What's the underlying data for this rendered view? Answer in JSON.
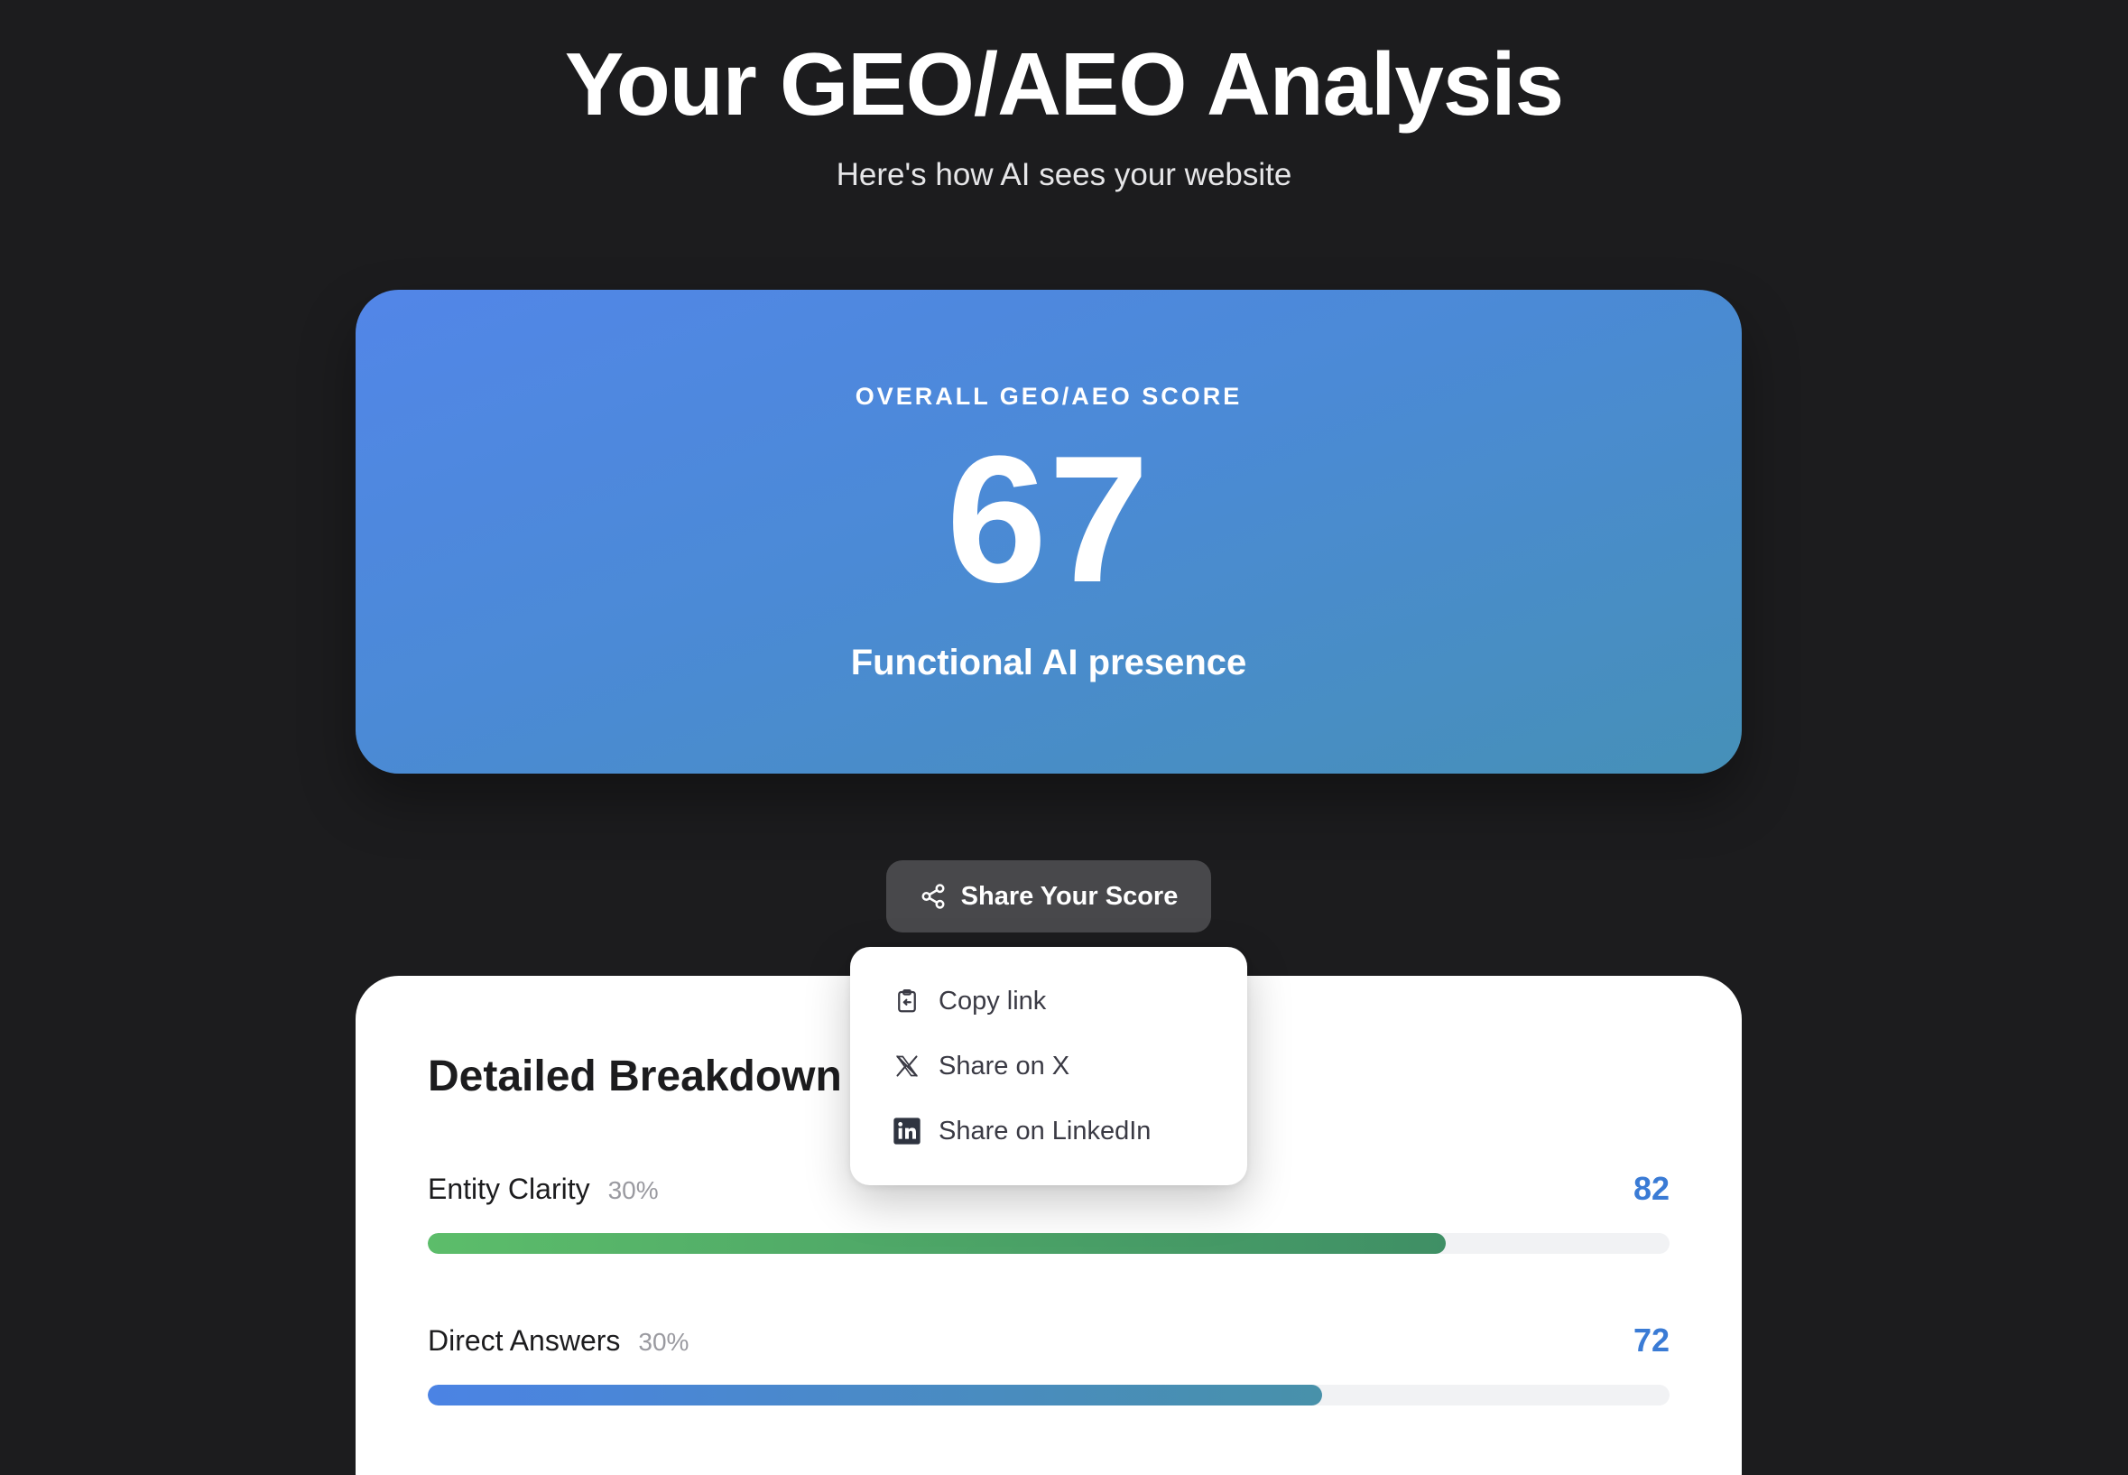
{
  "header": {
    "title": "Your GEO/AEO Analysis",
    "subtitle": "Here's how AI sees your website"
  },
  "score_card": {
    "label": "OVERALL GEO/AEO SCORE",
    "score": "67",
    "description": "Functional AI presence"
  },
  "share": {
    "button_label": "Share Your Score",
    "menu": [
      {
        "label": "Copy link",
        "icon": "clipboard-icon"
      },
      {
        "label": "Share on X",
        "icon": "x-logo-icon"
      },
      {
        "label": "Share on LinkedIn",
        "icon": "linkedin-icon"
      }
    ]
  },
  "breakdown": {
    "title": "Detailed Breakdown",
    "metrics": [
      {
        "name": "Entity Clarity",
        "weight": "30%",
        "score": "82",
        "fill": 0.82,
        "color": "#5cbd6a"
      },
      {
        "name": "Direct Answers",
        "weight": "30%",
        "score": "72",
        "fill": 0.72,
        "color": "#4b83e4"
      }
    ]
  },
  "colors": {
    "background": "#1c1c1e",
    "accent": "#3a7bd5",
    "card_gradient_start": "#5286e8",
    "card_gradient_end": "#4690b8"
  }
}
